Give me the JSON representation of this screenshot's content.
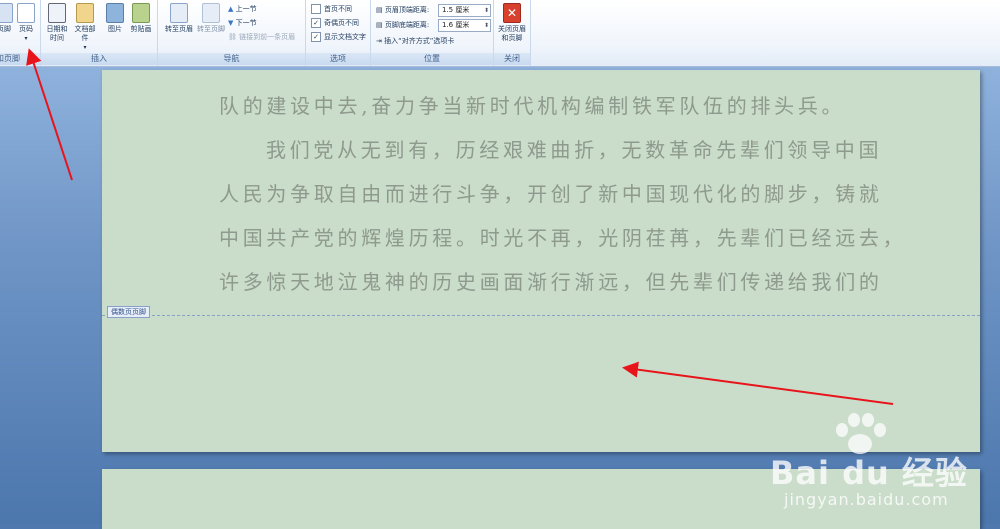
{
  "ribbon": {
    "groups": {
      "header_footer": {
        "label": "页眉和页脚",
        "items": [
          "页脚",
          "页码"
        ]
      },
      "insert": {
        "label": "插入",
        "items": [
          "日期和时间",
          "文档部件",
          "图片",
          "剪贴画"
        ]
      },
      "navigation": {
        "label": "导航",
        "goto_header": "转至页眉",
        "goto_footer": "转至页脚",
        "prev_section": "上一节",
        "next_section": "下一节",
        "link_prev": "链接到前一条页眉"
      },
      "options": {
        "label": "选项",
        "first_page": "首页不同",
        "odd_even": "奇偶页不同",
        "show_doc_text": "显示文档文字"
      },
      "position": {
        "label": "位置",
        "header_top": "页眉顶端距离:",
        "header_top_value": "1.5 厘米",
        "footer_bottom": "页脚底端距离:",
        "footer_bottom_value": "1.6 厘米",
        "insert_align_tab": "插入“对齐方式”选项卡"
      },
      "close": {
        "label": "关闭",
        "button": "关闭页眉和页脚"
      }
    }
  },
  "document": {
    "lines": [
      "队的建设中去,奋力争当新时代机构编制铁军队伍的排头兵。",
      "我们党从无到有，历经艰难曲折，无数革命先辈们领导中国",
      "人民为争取自由而进行斗争，开创了新中国现代化的脚步，铸就",
      "中国共产党的辉煌历程。时光不再，光阴荏苒，先辈们已经远去，",
      "许多惊天地泣鬼神的历史画面渐行渐远，但先辈们传递给我们的"
    ],
    "footer_tag": "偶数页页脚"
  },
  "watermark": {
    "logo": "Bai du 经验",
    "url": "jingyan.baidu.com"
  },
  "colors": {
    "annotation_arrow": "#e8141b",
    "page_bg": "#cadcca",
    "text": "#8e9a8e"
  }
}
